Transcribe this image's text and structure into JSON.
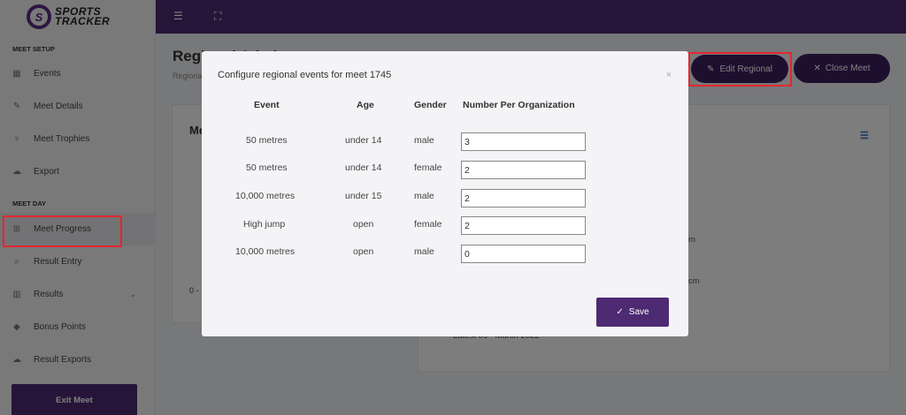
{
  "sidebar": {
    "logo_mark": "S",
    "logo_line1": "SPORTS",
    "logo_line2": "TRACKER",
    "meet_setup_title": "MEET SETUP",
    "meet_day_title": "MEET DAY",
    "setup_items": [
      {
        "label": "Events",
        "icon": "calendar-icon"
      },
      {
        "label": "Meet Details",
        "icon": "edit-icon"
      },
      {
        "label": "Meet Trophies",
        "icon": "trophy-icon"
      },
      {
        "label": "Export",
        "icon": "cloud-upload-icon"
      }
    ],
    "day_items": [
      {
        "label": "Meet Progress",
        "icon": "grid-icon"
      },
      {
        "label": "Result Entry",
        "icon": "search-icon"
      },
      {
        "label": "Results",
        "icon": "bar-chart-icon"
      },
      {
        "label": "Bonus Points",
        "icon": "diamond-icon"
      },
      {
        "label": "Result Exports",
        "icon": "cloud-upload-icon"
      }
    ],
    "exit_label": "Exit Meet"
  },
  "page": {
    "title": "Regional Admin",
    "subtitle": "Regional",
    "edit_label": "Edit Regional",
    "close_label": "Close Meet",
    "card_left_title": "Me",
    "card_left_value": "0 -",
    "frag1": "m",
    "frag2": "cm",
    "frag3": "Latest 09 - March 2022"
  },
  "modal": {
    "title": "Configure regional events for meet 1745",
    "close_symbol": "×",
    "headers": {
      "event": "Event",
      "age": "Age",
      "gender": "Gender",
      "number": "Number Per Organization"
    },
    "rows": [
      {
        "event": "50 metres",
        "age": "under 14",
        "gender": "male",
        "number": "3"
      },
      {
        "event": "50 metres",
        "age": "under 14",
        "gender": "female",
        "number": "2"
      },
      {
        "event": "10,000 metres",
        "age": "under 15",
        "gender": "male",
        "number": "2"
      },
      {
        "event": "High jump",
        "age": "open",
        "gender": "female",
        "number": "2"
      },
      {
        "event": "10,000 metres",
        "age": "open",
        "gender": "male",
        "number": "0"
      }
    ],
    "save_label": "Save"
  },
  "colors": {
    "brand_purple": "#4d2a72",
    "highlight_red": "#e5262f"
  }
}
